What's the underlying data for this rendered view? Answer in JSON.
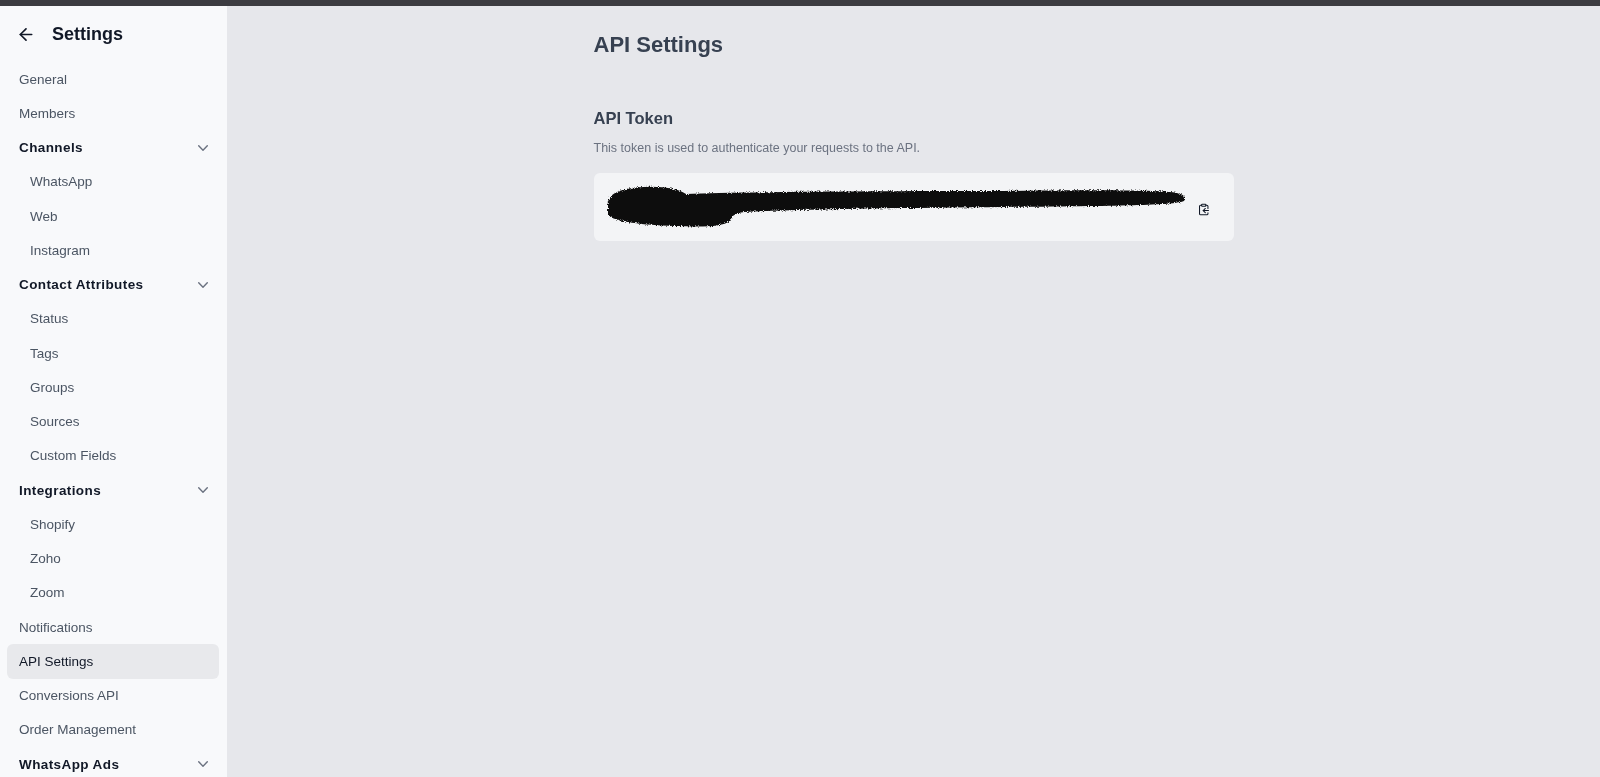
{
  "sidebar": {
    "title": "Settings",
    "items": [
      {
        "label": "General",
        "kind": "link",
        "selected": false
      },
      {
        "label": "Members",
        "kind": "link",
        "selected": false
      },
      {
        "label": "Channels",
        "kind": "group",
        "selected": false,
        "expanded": true,
        "children": [
          {
            "label": "WhatsApp",
            "kind": "link",
            "selected": false
          },
          {
            "label": "Web",
            "kind": "link",
            "selected": false
          },
          {
            "label": "Instagram",
            "kind": "link",
            "selected": false
          }
        ]
      },
      {
        "label": "Contact Attributes",
        "kind": "group",
        "selected": false,
        "expanded": true,
        "children": [
          {
            "label": "Status",
            "kind": "link",
            "selected": false
          },
          {
            "label": "Tags",
            "kind": "link",
            "selected": false
          },
          {
            "label": "Groups",
            "kind": "link",
            "selected": false
          },
          {
            "label": "Sources",
            "kind": "link",
            "selected": false
          },
          {
            "label": "Custom Fields",
            "kind": "link",
            "selected": false
          }
        ]
      },
      {
        "label": "Integrations",
        "kind": "group",
        "selected": false,
        "expanded": true,
        "children": [
          {
            "label": "Shopify",
            "kind": "link",
            "selected": false
          },
          {
            "label": "Zoho",
            "kind": "link",
            "selected": false
          },
          {
            "label": "Zoom",
            "kind": "link",
            "selected": false
          }
        ]
      },
      {
        "label": "Notifications",
        "kind": "link",
        "selected": false
      },
      {
        "label": "API Settings",
        "kind": "link",
        "selected": true
      },
      {
        "label": "Conversions API",
        "kind": "link",
        "selected": false
      },
      {
        "label": "Order Management",
        "kind": "link",
        "selected": false
      },
      {
        "label": "WhatsApp Ads",
        "kind": "group",
        "selected": false,
        "expanded": true
      }
    ]
  },
  "main": {
    "title": "API Settings",
    "section": {
      "title": "API Token",
      "description": "This token is used to authenticate your requests to the API.",
      "token": {
        "redacted": true
      }
    }
  }
}
